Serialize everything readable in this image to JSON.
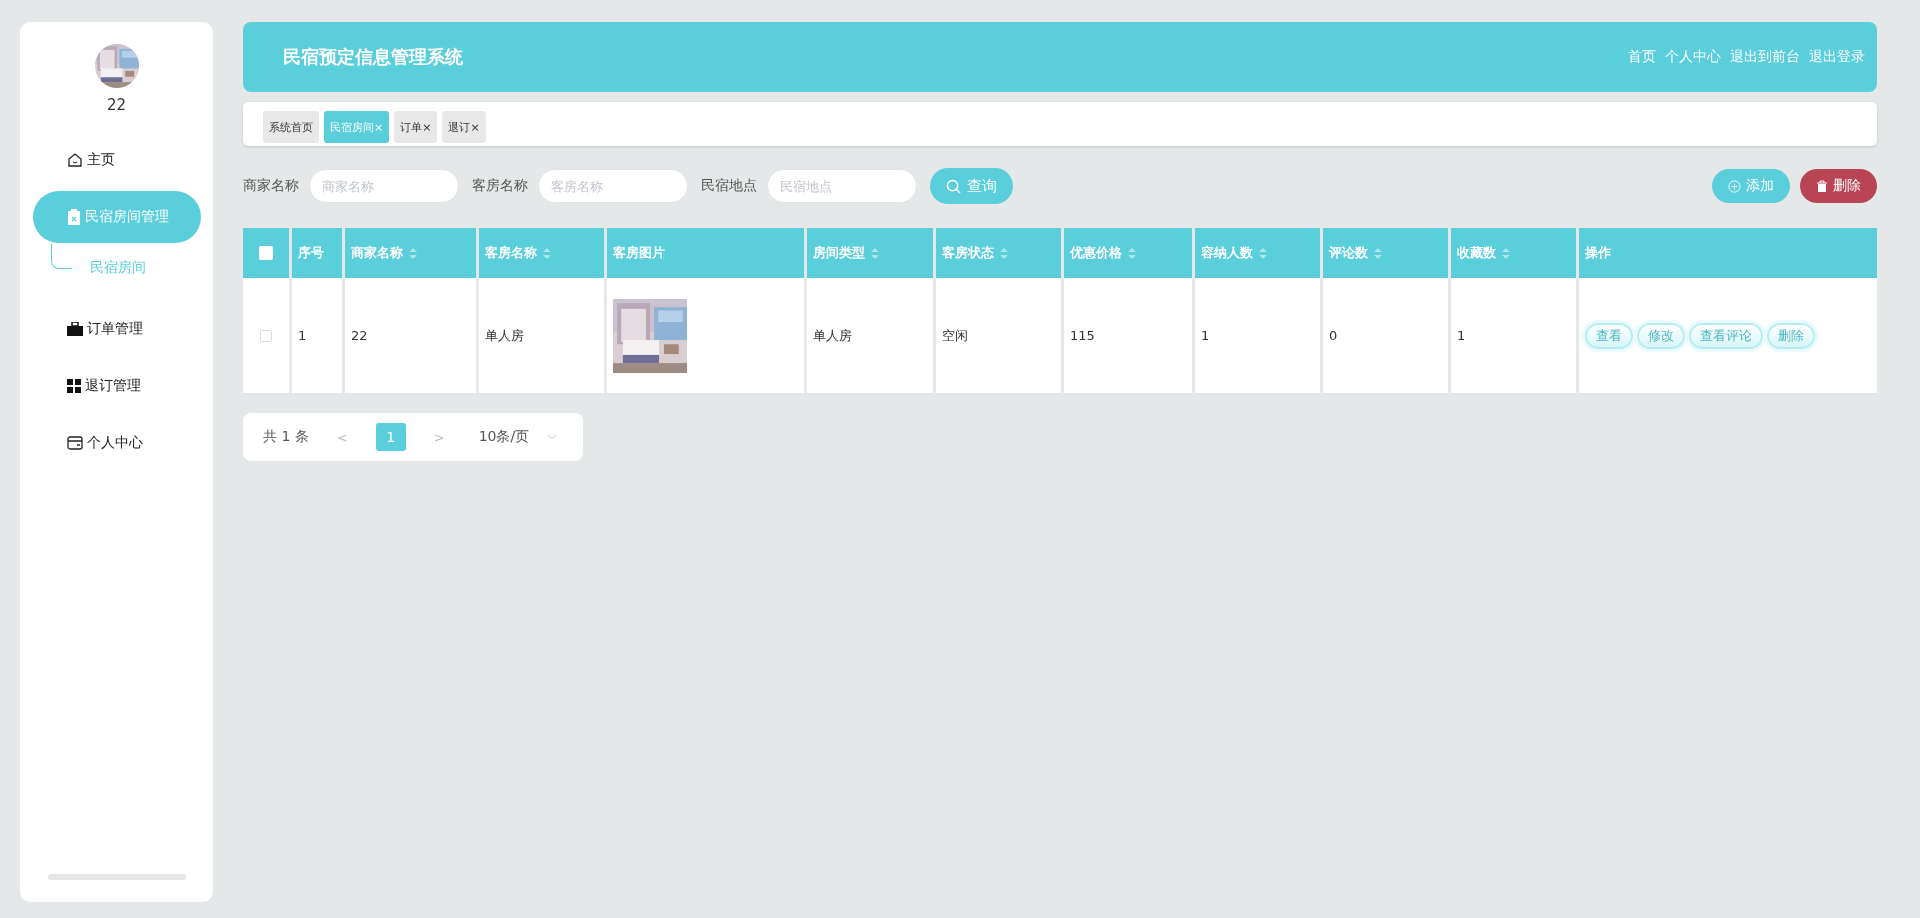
{
  "sidebar": {
    "user": {
      "name": "22",
      "avatar": {
        "kind": "picture"
      }
    },
    "items": [
      {
        "label": "主页",
        "selected": false
      },
      {
        "label": "民宿房间管理",
        "selected": true,
        "children": [
          {
            "label": "民宿房间",
            "selected": true
          }
        ]
      },
      {
        "label": "订单管理",
        "selected": false
      },
      {
        "label": "退订管理",
        "selected": false
      },
      {
        "label": "个人中心",
        "selected": false
      }
    ]
  },
  "header": {
    "title": "民宿预定信息管理系统",
    "links": [
      "首页",
      "个人中心",
      "退出到前台",
      "退出登录"
    ]
  },
  "tabs": [
    {
      "label": "系统首页",
      "closable": false,
      "selected": false
    },
    {
      "label": "民宿房间",
      "closable": true,
      "selected": true
    },
    {
      "label": "订单",
      "closable": true,
      "selected": false
    },
    {
      "label": "退订",
      "closable": true,
      "selected": false
    }
  ],
  "close_glyph": "×",
  "search": {
    "fields": [
      {
        "label": "商家名称",
        "placeholder": "商家名称"
      },
      {
        "label": "客房名称",
        "placeholder": "客房名称"
      },
      {
        "label": "民宿地点",
        "placeholder": "民宿地点"
      }
    ],
    "button": "查询"
  },
  "actions": [
    {
      "label": "添加",
      "kind": "add"
    },
    {
      "label": "删除",
      "kind": "delete"
    }
  ],
  "table": {
    "header_checked": false,
    "columns": [
      {
        "label": "序号",
        "sortable": false
      },
      {
        "label": "商家名称",
        "sortable": true
      },
      {
        "label": "客房名称",
        "sortable": true
      },
      {
        "label": "客房图片",
        "sortable": false
      },
      {
        "label": "房间类型",
        "sortable": true
      },
      {
        "label": "客房状态",
        "sortable": true
      },
      {
        "label": "优惠价格",
        "sortable": true
      },
      {
        "label": "容纳人数",
        "sortable": true
      },
      {
        "label": "评论数",
        "sortable": true
      },
      {
        "label": "收藏数",
        "sortable": true
      },
      {
        "label": "操作",
        "sortable": false
      }
    ],
    "rows": [
      {
        "checked": false,
        "cells": [
          "1",
          "22",
          "单人房",
          {
            "kind": "picture"
          },
          "单人房",
          "空闲",
          "115",
          "1",
          "0",
          "1"
        ],
        "buttons": [
          "查看",
          "修改",
          "查看评论",
          "删除"
        ]
      }
    ]
  },
  "pagination": {
    "total": "共 1 条",
    "prev": "<",
    "pages": [
      {
        "label": "1",
        "selected": true
      }
    ],
    "next": ">",
    "page_size": "10条/页"
  }
}
